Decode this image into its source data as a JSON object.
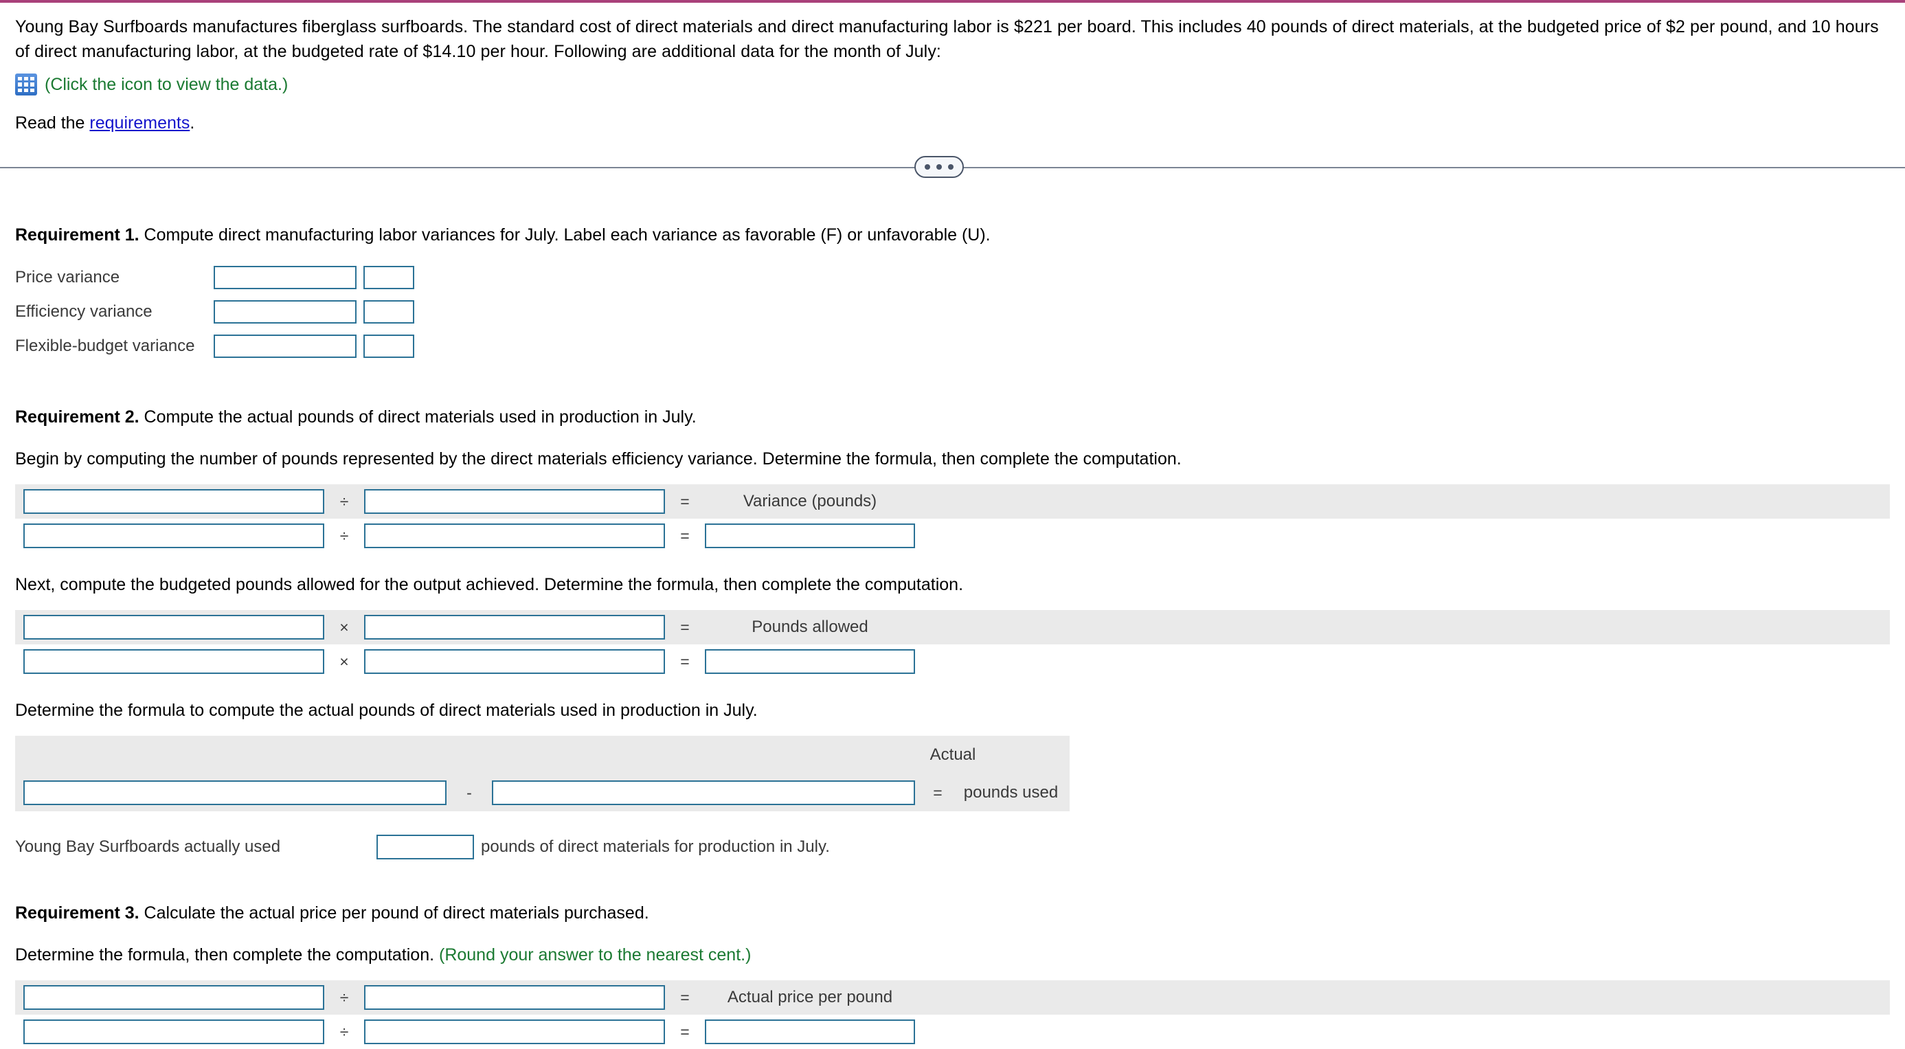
{
  "intro": {
    "paragraph": "Young Bay Surfboards manufactures fiberglass surfboards. The standard cost of direct materials and direct manufacturing labor is $221 per board. This includes 40 pounds of direct materials, at the budgeted price of $2 per pound, and 10 hours of direct manufacturing labor, at the budgeted rate of $14.10 per hour. Following are additional data for the month of July:",
    "data_link_text": "(Click the icon to view the data.)",
    "read_prefix": "Read the ",
    "read_link": "requirements",
    "read_suffix": "."
  },
  "requirement1": {
    "label": "Requirement 1.",
    "text": " Compute direct manufacturing labor variances for July. Label each variance as favorable (F) or unfavorable (U).",
    "rows": [
      {
        "label": "Price variance"
      },
      {
        "label": "Efficiency variance"
      },
      {
        "label": "Flexible-budget variance"
      }
    ]
  },
  "requirement2": {
    "label": "Requirement 2.",
    "text": " Compute the actual pounds of direct materials used in production in July.",
    "variance_prompt": "Begin by computing the number of pounds represented by the direct materials efficiency variance. Determine the formula, then complete the computation.",
    "variance_op": "÷",
    "variance_eq": "=",
    "variance_result_label": "Variance (pounds)",
    "pounds_prompt": "Next, compute the budgeted pounds allowed for the output achieved. Determine the formula, then complete the computation.",
    "pounds_op": "×",
    "pounds_eq": "=",
    "pounds_result_label": "Pounds allowed",
    "actual_prompt": "Determine the formula to compute the actual pounds of direct materials used in production in July.",
    "actual_minus": "-",
    "actual_eq": "=",
    "actual_label_line1": "Actual",
    "actual_label_line2": "pounds used",
    "sentence_lead": "Young Bay Surfboards actually used",
    "sentence_tail": "pounds of direct materials for production in July."
  },
  "requirement3": {
    "label": "Requirement 3.",
    "text": " Calculate the actual price per pound of direct materials purchased.",
    "prompt": "Determine the formula, then complete the computation. ",
    "prompt_hint": "(Round your answer to the nearest cent.)",
    "op": "÷",
    "eq": "=",
    "result_label": "Actual price per pound"
  },
  "colors": {
    "input_border": "#2b7296",
    "shaded_band": "#eaeaea",
    "link": "#1414cc",
    "green_hint": "#1b7a32",
    "top_rule": "#a9417a"
  }
}
